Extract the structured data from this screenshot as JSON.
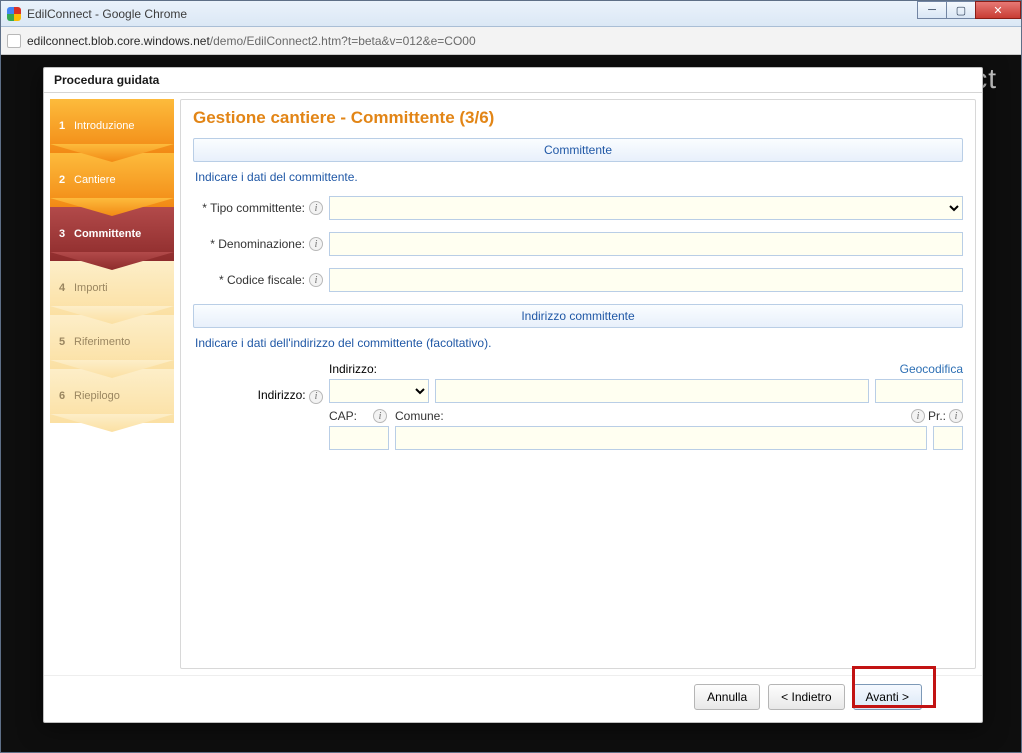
{
  "browser": {
    "title": "EdilConnect - Google Chrome",
    "url_host": "edilconnect.blob.core.windows.net",
    "url_path": "/demo/EdilConnect2.htm?t=beta&v=012&e=CO00",
    "brand": "EdilConnect"
  },
  "modal": {
    "title": "Procedura guidata",
    "page_heading": "Gestione cantiere - Committente (3/6)",
    "buttons": {
      "cancel": "Annulla",
      "back": "< Indietro",
      "next": "Avanti >"
    }
  },
  "wizard": {
    "steps": [
      {
        "num": "1",
        "label": "Introduzione",
        "state": "done"
      },
      {
        "num": "2",
        "label": "Cantiere",
        "state": "done"
      },
      {
        "num": "3",
        "label": "Committente",
        "state": "active"
      },
      {
        "num": "4",
        "label": "Importi",
        "state": "future"
      },
      {
        "num": "5",
        "label": "Riferimento",
        "state": "future"
      },
      {
        "num": "6",
        "label": "Riepilogo",
        "state": "future"
      }
    ]
  },
  "sections": {
    "committente": {
      "header": "Committente",
      "instruction": "Indicare i dati del committente.",
      "fields": {
        "tipo_label": "* Tipo committente:",
        "tipo_value": "",
        "denominazione_label": "* Denominazione:",
        "denominazione_value": "",
        "cf_label": "* Codice fiscale:",
        "cf_value": ""
      }
    },
    "indirizzo": {
      "header": "Indirizzo committente",
      "instruction": "Indicare i dati dell'indirizzo del committente (facoltativo).",
      "labels": {
        "indirizzo_side": "Indirizzo:",
        "indirizzo_top": "Indirizzo:",
        "geocodifica": "Geocodifica",
        "cap": "CAP:",
        "comune": "Comune:",
        "pr": "Pr.:"
      },
      "values": {
        "tipo_via": "",
        "via": "",
        "civico": "",
        "cap": "",
        "comune": "",
        "pr": ""
      }
    }
  }
}
